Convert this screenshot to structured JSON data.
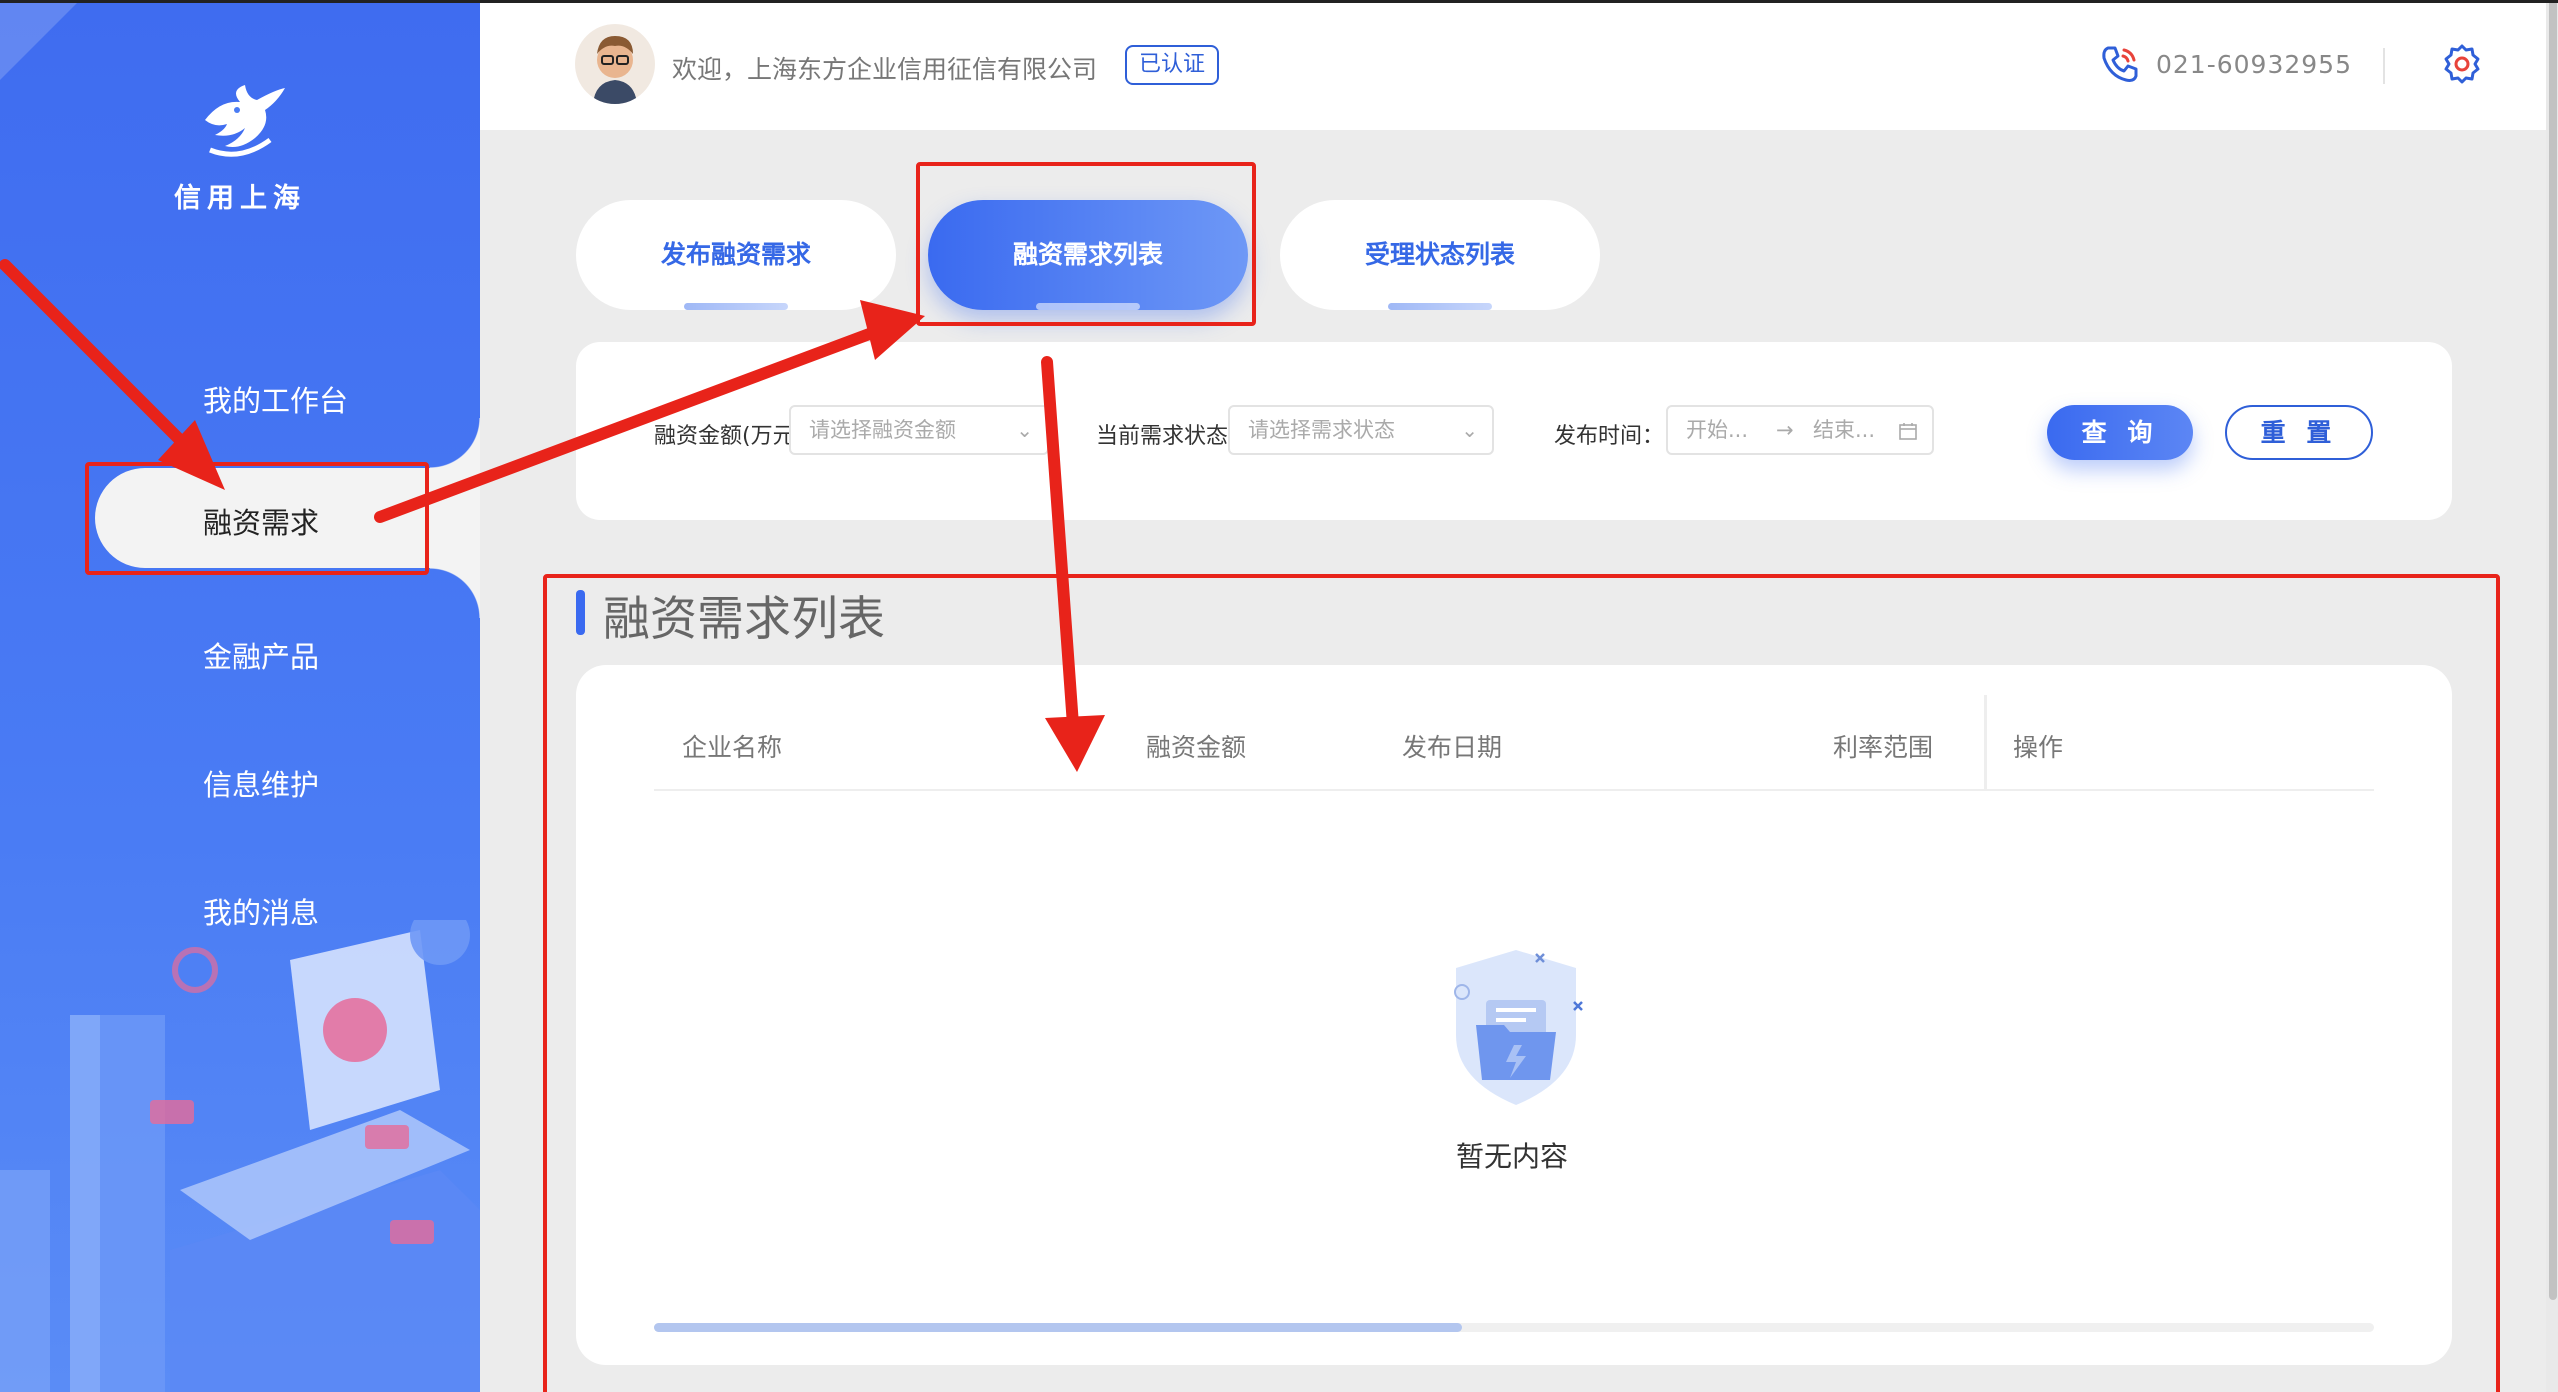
{
  "brand": {
    "logo_text": "信用上海"
  },
  "sidebar": {
    "items": [
      {
        "label": "我的工作台",
        "active": false
      },
      {
        "label": "融资需求",
        "active": true
      },
      {
        "label": "金融产品",
        "active": false
      },
      {
        "label": "信息维护",
        "active": false
      },
      {
        "label": "我的消息",
        "active": false
      }
    ]
  },
  "header": {
    "welcome": "欢迎，上海东方企业信用征信有限公司",
    "verified_badge": "已认证",
    "phone": "021-60932955",
    "icons": {
      "phone": "phone-icon",
      "settings": "gear-icon"
    }
  },
  "tabs": [
    {
      "label": "发布融资需求",
      "active": false
    },
    {
      "label": "融资需求列表",
      "active": true
    },
    {
      "label": "受理状态列表",
      "active": false
    }
  ],
  "filters": {
    "amount_label": "融资金额(万元",
    "amount_placeholder": "请选择融资金额",
    "status_label": "当前需求状态",
    "status_placeholder": "请选择需求状态",
    "date_label": "发布时间：",
    "date_start": "开始...",
    "date_arrow": "→",
    "date_end": "结束...",
    "query_button": "查 询",
    "reset_button": "重 置"
  },
  "list": {
    "title": "融资需求列表",
    "columns": [
      "企业名称",
      "融资金额",
      "发布日期",
      "利率范围",
      "操作"
    ],
    "rows": [],
    "empty_text": "暂无内容",
    "horizontal_scroll_fraction": 0.47
  },
  "colors": {
    "primary": "#3a6af0",
    "sidebar": "#4a7cf4",
    "annotation": "#e8231a"
  }
}
